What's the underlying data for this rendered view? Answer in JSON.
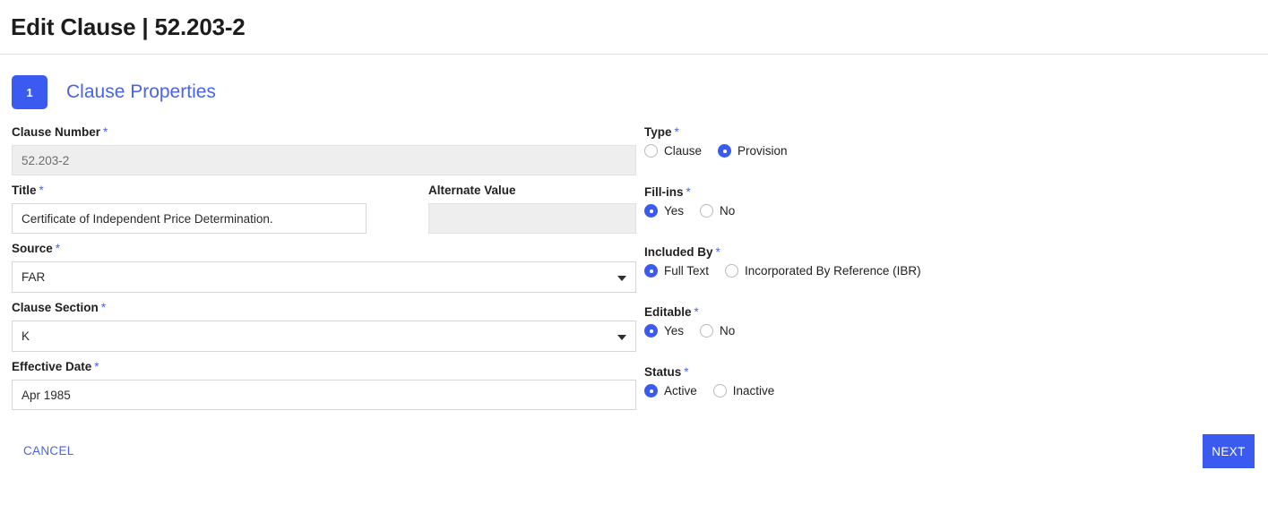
{
  "header": {
    "title": "Edit Clause | 52.203-2"
  },
  "step": {
    "number": "1",
    "label": "Clause Properties"
  },
  "required_marker": "*",
  "colors": {
    "accent": "#3b5bf0",
    "link": "#4a63e7",
    "disabled_bg": "#eeeeee",
    "border": "#d6d6d6"
  },
  "left_column": {
    "clause_number": {
      "label": "Clause Number",
      "required": true,
      "value": "52.203-2",
      "placeholder": "",
      "disabled": true
    },
    "title": {
      "label": "Title",
      "required": true,
      "value": "Certificate of Independent Price Determination.",
      "placeholder": "",
      "disabled": false
    },
    "alternate_value": {
      "label": "Alternate Value",
      "required": false,
      "value": "",
      "placeholder": "",
      "disabled": true
    },
    "source": {
      "label": "Source",
      "required": true,
      "value": "FAR",
      "options": [
        "FAR"
      ]
    },
    "clause_section": {
      "label": "Clause Section",
      "required": true,
      "value": "K",
      "options": [
        "K"
      ]
    },
    "effective_date": {
      "label": "Effective Date",
      "required": true,
      "value": "Apr 1985",
      "placeholder": "",
      "disabled": false
    }
  },
  "right_column": {
    "type": {
      "label": "Type",
      "required": true,
      "options": [
        {
          "label": "Clause",
          "selected": false
        },
        {
          "label": "Provision",
          "selected": true
        }
      ]
    },
    "fill_ins": {
      "label": "Fill-ins",
      "required": true,
      "options": [
        {
          "label": "Yes",
          "selected": true
        },
        {
          "label": "No",
          "selected": false
        }
      ]
    },
    "included_by": {
      "label": "Included By",
      "required": true,
      "options": [
        {
          "label": "Full Text",
          "selected": true
        },
        {
          "label": "Incorporated By Reference (IBR)",
          "selected": false
        }
      ]
    },
    "editable": {
      "label": "Editable",
      "required": true,
      "options": [
        {
          "label": "Yes",
          "selected": true
        },
        {
          "label": "No",
          "selected": false
        }
      ]
    },
    "status": {
      "label": "Status",
      "required": true,
      "options": [
        {
          "label": "Active",
          "selected": true
        },
        {
          "label": "Inactive",
          "selected": false
        }
      ]
    }
  },
  "footer": {
    "cancel_label": "CANCEL",
    "next_label": "NEXT"
  }
}
